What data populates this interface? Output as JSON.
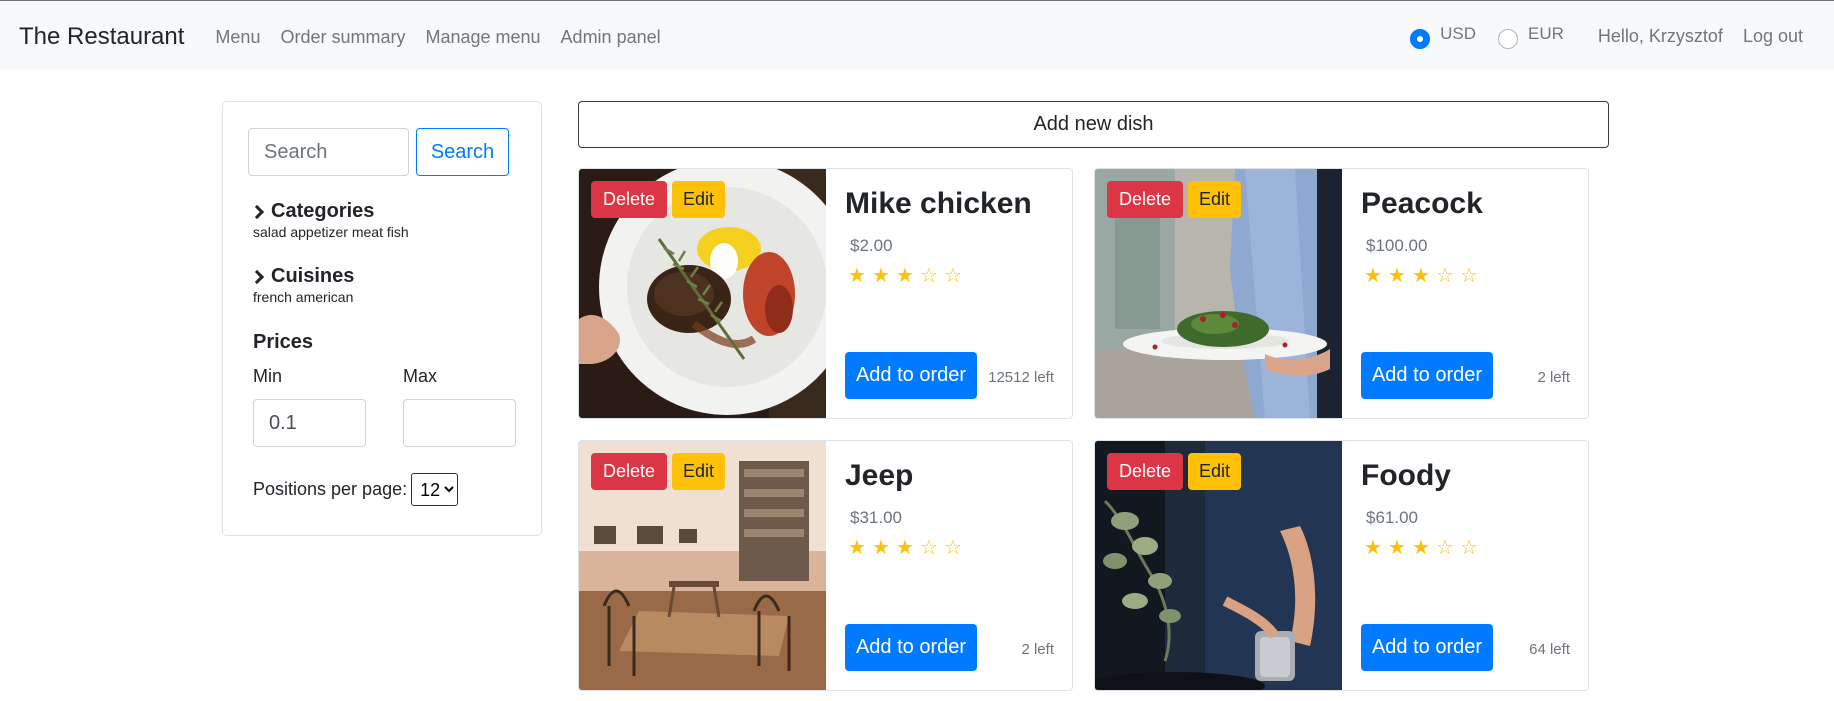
{
  "navbar": {
    "brand": "The Restaurant",
    "links": [
      "Menu",
      "Order summary",
      "Manage menu",
      "Admin panel"
    ],
    "currencies": [
      {
        "label": "USD",
        "checked": true
      },
      {
        "label": "EUR",
        "checked": false
      }
    ],
    "greeting": "Hello, Krzysztof",
    "logout": "Log out"
  },
  "sidebar": {
    "search_placeholder": "Search",
    "search_button": "Search",
    "categories_title": "Categories",
    "categories_list": "salad appetizer meat fish",
    "cuisines_title": "Cuisines",
    "cuisines_list": "french american",
    "prices_title": "Prices",
    "min_label": "Min",
    "max_label": "Max",
    "min_value": "0.1",
    "max_value": "",
    "positions_label": "Positions per page:",
    "positions_value": "12"
  },
  "main": {
    "add_dish_label": "Add new dish",
    "delete_label": "Delete",
    "edit_label": "Edit",
    "add_to_order_label": "Add to order",
    "star_color": "#ffc107",
    "dishes": [
      {
        "name": "Mike chicken",
        "price": "$2.00",
        "rating": 3,
        "max_rating": 5,
        "left": "12512 left"
      },
      {
        "name": "Peacock",
        "price": "$100.00",
        "rating": 3,
        "max_rating": 5,
        "left": "2 left"
      },
      {
        "name": "Jeep",
        "price": "$31.00",
        "rating": 3,
        "max_rating": 5,
        "left": "2 left"
      },
      {
        "name": "Foody",
        "price": "$61.00",
        "rating": 3,
        "max_rating": 5,
        "left": "64 left"
      }
    ]
  }
}
